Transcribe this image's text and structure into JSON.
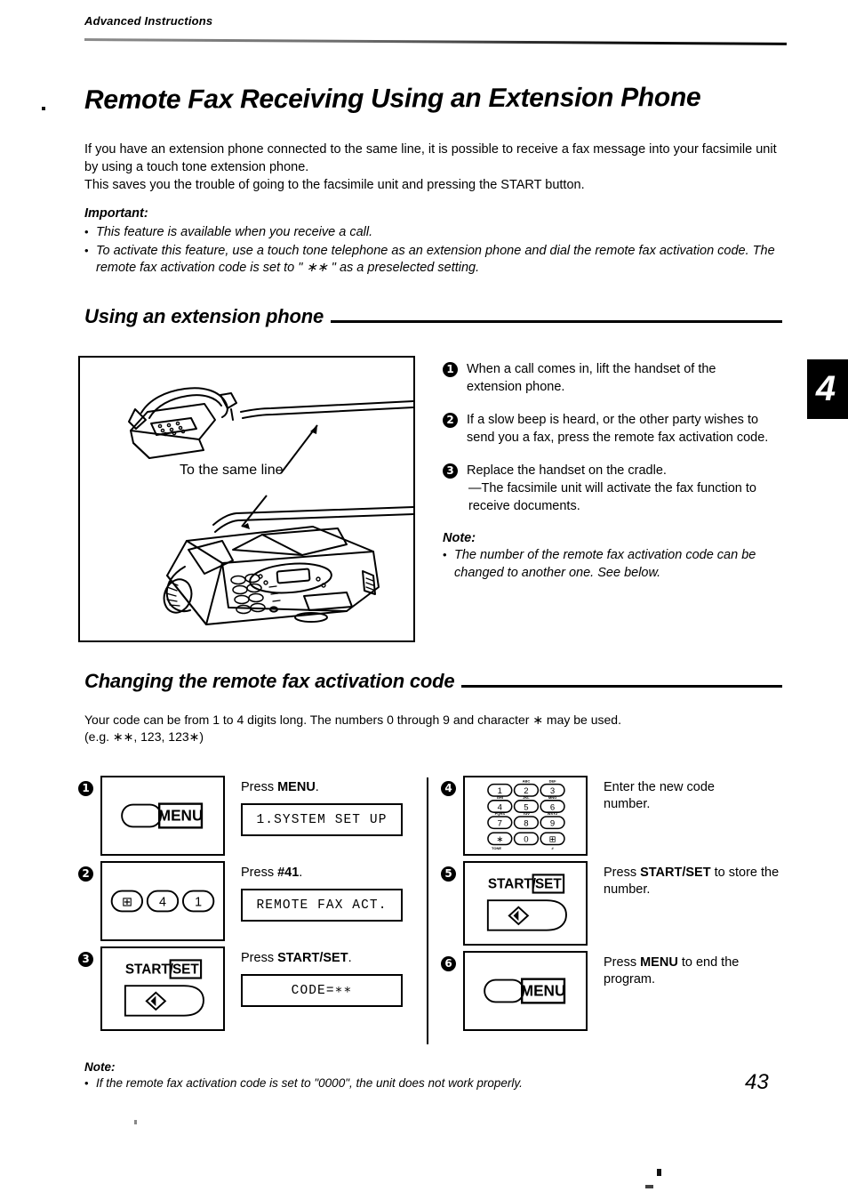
{
  "running_head": "Advanced Instructions",
  "title": "Remote Fax Receiving Using an Extension Phone",
  "page_number": "43",
  "chapter_tab": "4",
  "intro": {
    "line1": "If you have an extension phone connected to the same line, it is possible to receive a fax message into your facsimile unit by using a touch tone extension phone.",
    "line2": "This saves you the trouble of going to the facsimile unit and pressing the START button."
  },
  "important": {
    "heading": "Important:",
    "items": [
      "This feature is available when you receive a call.",
      "To activate this feature, use a touch tone telephone as an extension phone and dial the remote fax activation code. The remote fax activation code is set to \" ∗∗ \" as a preselected setting."
    ]
  },
  "section_using": {
    "heading": "Using an extension phone",
    "illustration": {
      "caption": "To the same line",
      "devices": [
        "extension-telephone",
        "facsimile-unit"
      ]
    },
    "steps": [
      {
        "num": "1",
        "text": "When a call comes in, lift the handset of the extension phone."
      },
      {
        "num": "2",
        "text": "If a slow beep is heard, or the other party wishes to send you a fax, press the remote fax activation code."
      },
      {
        "num": "3",
        "text": "Replace the handset on the cradle.",
        "sub": "—The facsimile unit will activate the fax function to receive documents."
      }
    ],
    "note": {
      "heading": "Note:",
      "body": "The number of the remote fax activation code can be changed to another one. See below."
    }
  },
  "section_changing": {
    "heading": "Changing the remote fax activation code",
    "intro_line1": "Your code can be from 1 to 4 digits long. The numbers 0 through 9 and character ∗ may be used.",
    "intro_line2": "(e.g. ∗∗, 123, 123∗)",
    "steps": [
      {
        "num": "1",
        "button_type": "menu-button",
        "button_label": "MENU",
        "instruction_prefix": "Press ",
        "instruction_bold": "MENU",
        "instruction_suffix": ".",
        "lcd": "1.SYSTEM SET UP"
      },
      {
        "num": "2",
        "button_type": "key-trio",
        "keys": [
          "⊞",
          "4",
          "1"
        ],
        "instruction_prefix": "Press ",
        "instruction_bold": "#41",
        "instruction_suffix": ".",
        "lcd": "REMOTE FAX ACT."
      },
      {
        "num": "3",
        "button_type": "start-set-button",
        "button_label_plain": "START/",
        "button_label_boxed": "SET",
        "instruction_prefix": "Press ",
        "instruction_bold": "START/SET",
        "instruction_suffix": ".",
        "lcd": "CODE=∗∗"
      },
      {
        "num": "4",
        "button_type": "keypad",
        "keypad_rows": [
          [
            {
              "digit": "1",
              "letters": ""
            },
            {
              "digit": "2",
              "letters": "ABC"
            },
            {
              "digit": "3",
              "letters": "DEF"
            }
          ],
          [
            {
              "digit": "4",
              "letters": "GHI"
            },
            {
              "digit": "5",
              "letters": "JKL"
            },
            {
              "digit": "6",
              "letters": "MNO"
            }
          ],
          [
            {
              "digit": "7",
              "letters": "PQRS"
            },
            {
              "digit": "8",
              "letters": "TUV"
            },
            {
              "digit": "9",
              "letters": "WXYZ"
            }
          ],
          [
            {
              "digit": "∗",
              "letters": ""
            },
            {
              "digit": "0",
              "letters": ""
            },
            {
              "digit": "⊞",
              "letters": ""
            }
          ]
        ],
        "instruction_line1": "Enter the new code",
        "instruction_line2": "number."
      },
      {
        "num": "5",
        "button_type": "start-set-button",
        "button_label_plain": "START/",
        "button_label_boxed": "SET",
        "instruction_prefix": "Press ",
        "instruction_bold": "START/SET",
        "instruction_suffix": " to store the number."
      },
      {
        "num": "6",
        "button_type": "menu-button",
        "button_label": "MENU",
        "instruction_prefix": "Press ",
        "instruction_bold": "MENU",
        "instruction_suffix": " to end the program."
      }
    ],
    "note": {
      "heading": "Note:",
      "body": "If the remote fax activation code is set to \"0000\", the unit does not work properly."
    }
  }
}
